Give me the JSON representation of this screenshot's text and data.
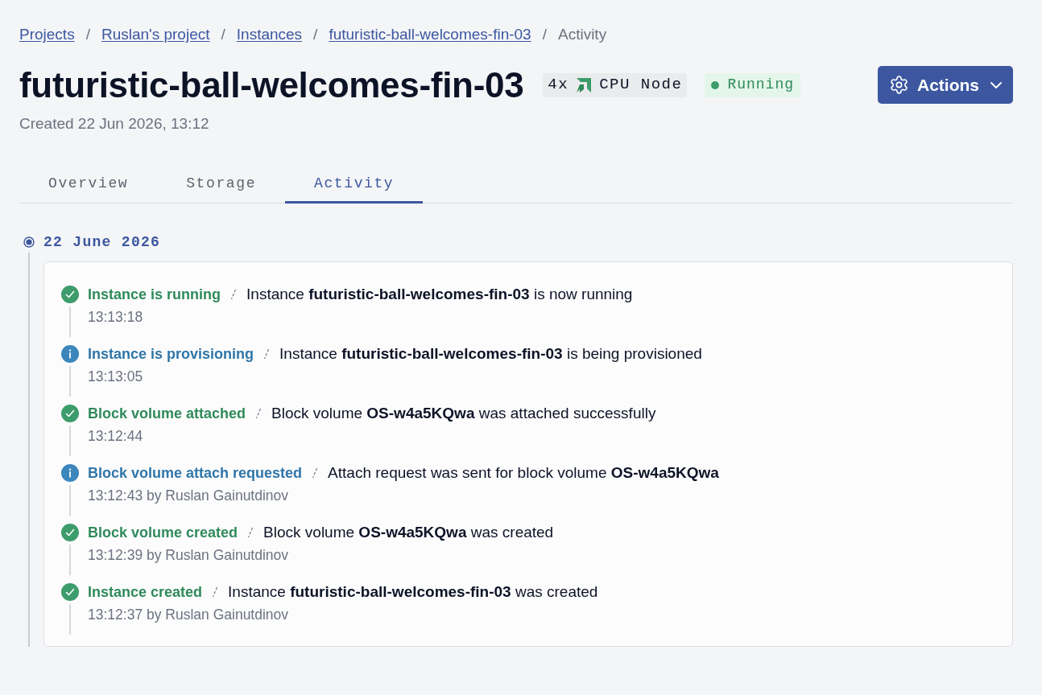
{
  "breadcrumb": [
    {
      "label": "Projects",
      "current": false
    },
    {
      "separator": "/",
      "label": "Ruslan's project",
      "current": false
    },
    {
      "separator": "/",
      "label": "Instances",
      "current": false
    },
    {
      "separator": "/",
      "label": "futuristic-ball-welcomes-fin-03",
      "current": false
    },
    {
      "separator": "/",
      "label": "Activity",
      "current": true
    }
  ],
  "title": "futuristic-ball-welcomes-fin-03",
  "node_badge": {
    "count": "4x",
    "label": "CPU Node"
  },
  "status": {
    "kind": "running",
    "label": "Running"
  },
  "actions_button": {
    "label": "Actions"
  },
  "created": "Created 22 Jun 2026, 13:12",
  "tabs": [
    {
      "label": "Overview",
      "selected": false
    },
    {
      "label": "Storage",
      "selected": false
    },
    {
      "label": "Activity",
      "selected": true
    }
  ],
  "timeline": {
    "date": "22 June 2026",
    "events": [
      {
        "kind": "success",
        "title": "Instance is running",
        "description": "Instance **futuristic-ball-welcomes-fin-03** is now running",
        "time": "13:13:18"
      },
      {
        "kind": "info",
        "title": "Instance is provisioning",
        "description": "Instance **futuristic-ball-welcomes-fin-03** is being provisioned",
        "time": "13:13:05"
      },
      {
        "kind": "success",
        "title": "Block volume attached",
        "description": "Block volume **OS-w4a5KQwa** was attached successfully",
        "time": "13:12:44"
      },
      {
        "kind": "info",
        "title": "Block volume attach requested",
        "description": "Attach request was sent for block volume **OS-w4a5KQwa**",
        "time": "13:12:43 by Ruslan Gainutdinov"
      },
      {
        "kind": "success",
        "title": "Block volume created",
        "description": "Block volume **OS-w4a5KQwa** was created",
        "time": "13:12:39 by Ruslan Gainutdinov"
      },
      {
        "kind": "success",
        "title": "Instance created",
        "description": "Instance **futuristic-ball-welcomes-fin-03** was created",
        "time": "13:12:37 by Ruslan Gainutdinov"
      }
    ]
  }
}
